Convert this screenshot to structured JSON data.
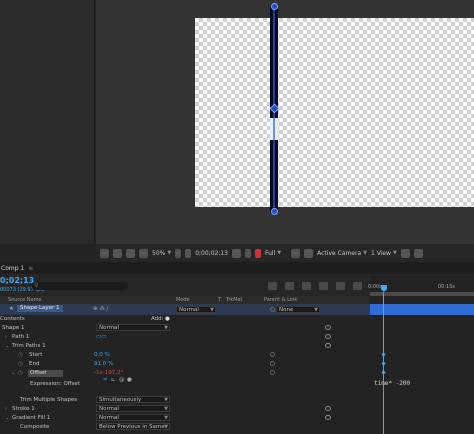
{
  "viewer": {
    "zoom": "50%",
    "timecode": "0;00;02;13",
    "resolution": "Full",
    "camera": "Active Camera",
    "view": "1 View"
  },
  "timeline": {
    "tab_label": "Comp 1",
    "current_time": "0;02;13",
    "current_frames": "00073 (29.97 fps)",
    "ruler_labels": [
      "0:00s",
      "00:15s"
    ],
    "headers": {
      "source_name": "Source Name",
      "mode": "Mode",
      "t": "T",
      "trkmat": "TrkMat",
      "parent": "Parent & Link"
    },
    "layer": {
      "name": "Shape Layer 1",
      "mode": "Normal",
      "parent": "None"
    },
    "contents_label": "Contents",
    "add_label": "Add:",
    "rows": {
      "shape1": {
        "label": "Shape 1",
        "mode": "Normal"
      },
      "path1": {
        "label": "Path 1"
      },
      "trim_paths": {
        "label": "Trim Paths 1"
      },
      "start": {
        "label": "Start",
        "value": "0.0 %"
      },
      "end": {
        "label": "End",
        "value": "91.0 %"
      },
      "offset": {
        "label": "Offset",
        "value": "-1x-197.2°"
      },
      "expression": {
        "label": "Expression: Offset"
      },
      "trim_multiple": {
        "label": "Trim Multiple Shapes",
        "value": "Simultaneously"
      },
      "stroke": {
        "label": "Stroke 1",
        "mode": "Normal"
      },
      "gradient": {
        "label": "Gradient Fill 1",
        "mode": "Normal"
      },
      "composite": {
        "label": "Composite",
        "value": "Below Previous in Same"
      }
    },
    "expression_text": "time* -200"
  },
  "colors": {
    "accent_blue": "#3fa9f5",
    "layer_bar": "#2f6cd3",
    "offset_red": "#e04545"
  }
}
